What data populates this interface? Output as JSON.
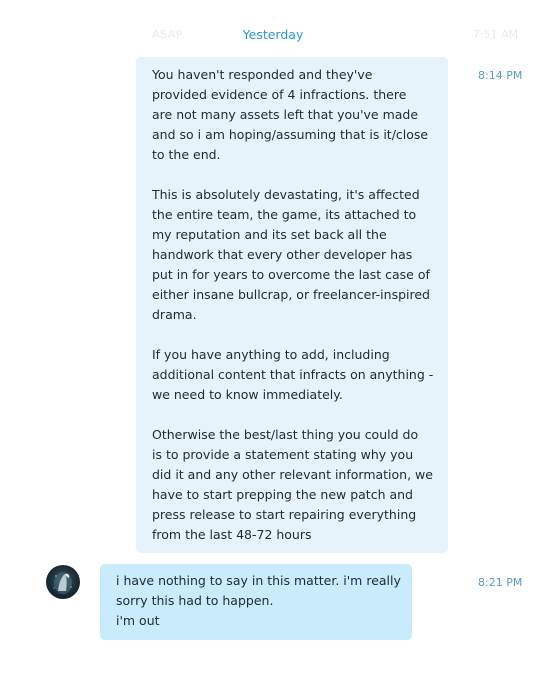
{
  "header": {
    "ghost_left": "ASAP",
    "ghost_right": "7:51 AM",
    "date_divider": "Yesterday"
  },
  "messages": [
    {
      "direction": "outgoing",
      "time": "8:14 PM",
      "paragraphs": [
        [
          "You haven't responded and they've",
          "provided evidence of 4 infractions.  there",
          "are not many assets left that you've made",
          "and so i am hoping/assuming that is it/close",
          "to the end."
        ],
        [
          "This is absolutely devastating, it's affected",
          "the entire team, the game, its attached to",
          "my reputation and its set back all the",
          "handwork that every other developer has",
          "put in for years to overcome the last case of",
          "either insane bullcrap, or freelancer-inspired",
          "drama."
        ],
        [
          "If you have anything to add, including",
          "additional content that infracts on anything -",
          "we need to know immediately."
        ],
        [
          "Otherwise the best/last thing you could do",
          "is to provide a statement stating why you",
          "did it and any other relevant information, we",
          "have to start prepping the new patch and",
          "press release to start repairing everything",
          "from the last 48-72 hours"
        ]
      ]
    },
    {
      "direction": "incoming",
      "time": "8:21 PM",
      "avatar_icon": "user-avatar",
      "paragraphs": [
        [
          "i have nothing to say in this matter. i'm really",
          "sorry this had to happen.",
          "i'm out"
        ]
      ]
    }
  ],
  "colors": {
    "outgoing_bubble": "#e6f3fa",
    "incoming_bubble": "#c9ebfb",
    "date_divider": "#2a97d2",
    "timestamp": "#5a9bbf"
  }
}
